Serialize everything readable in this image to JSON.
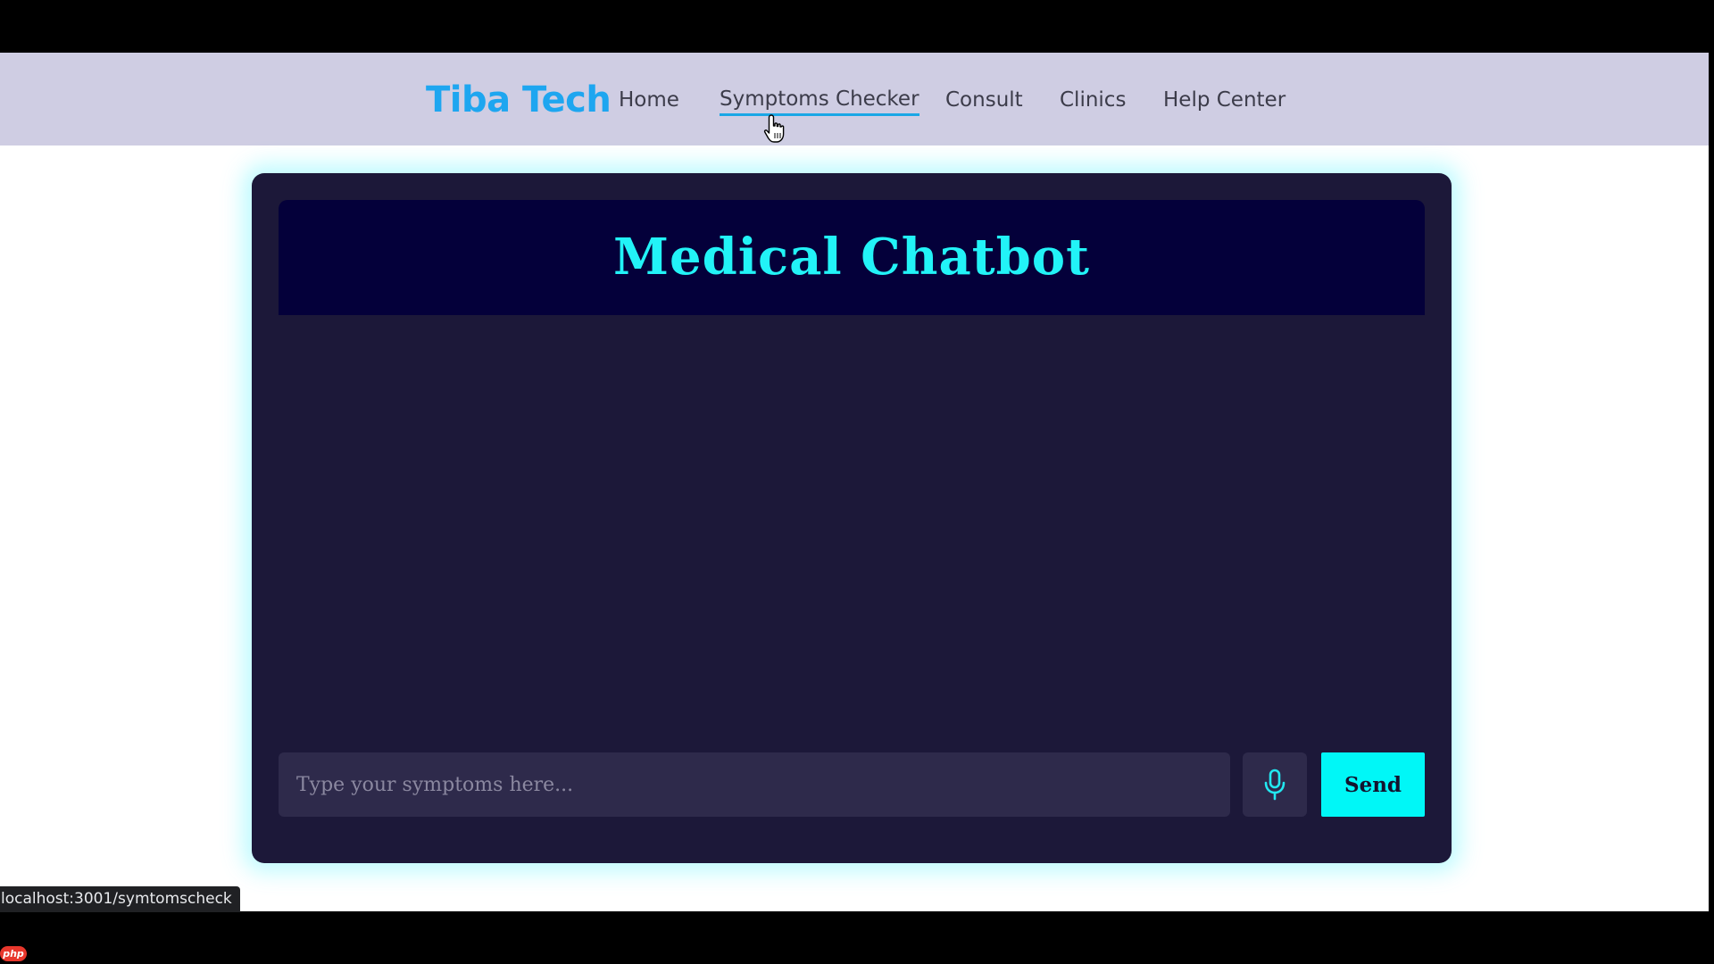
{
  "navbar": {
    "brand": "Tiba Tech",
    "links": [
      {
        "label": "Home",
        "active": false
      },
      {
        "label": "Symptoms Checker",
        "active": true
      },
      {
        "label": "Consult",
        "active": false
      },
      {
        "label": "Clinics",
        "active": false
      },
      {
        "label": "Help Center",
        "active": false
      }
    ]
  },
  "chat": {
    "title": "Medical Chatbot",
    "messages": [],
    "input": {
      "value": "",
      "placeholder": "Type your symptoms here..."
    },
    "mic_icon": "microphone-icon",
    "send_label": "Send"
  },
  "status_bar": {
    "url": "localhost:3001/symtomscheck"
  },
  "badge": {
    "label": "php"
  },
  "colors": {
    "navbar_bg": "#cfcde3",
    "brand": "#1ea6f0",
    "card_bg": "#1c1839",
    "header_bg": "#04003a",
    "title": "#22f3f7",
    "send_bg": "#00f7f7",
    "glow": "#b4faff"
  }
}
